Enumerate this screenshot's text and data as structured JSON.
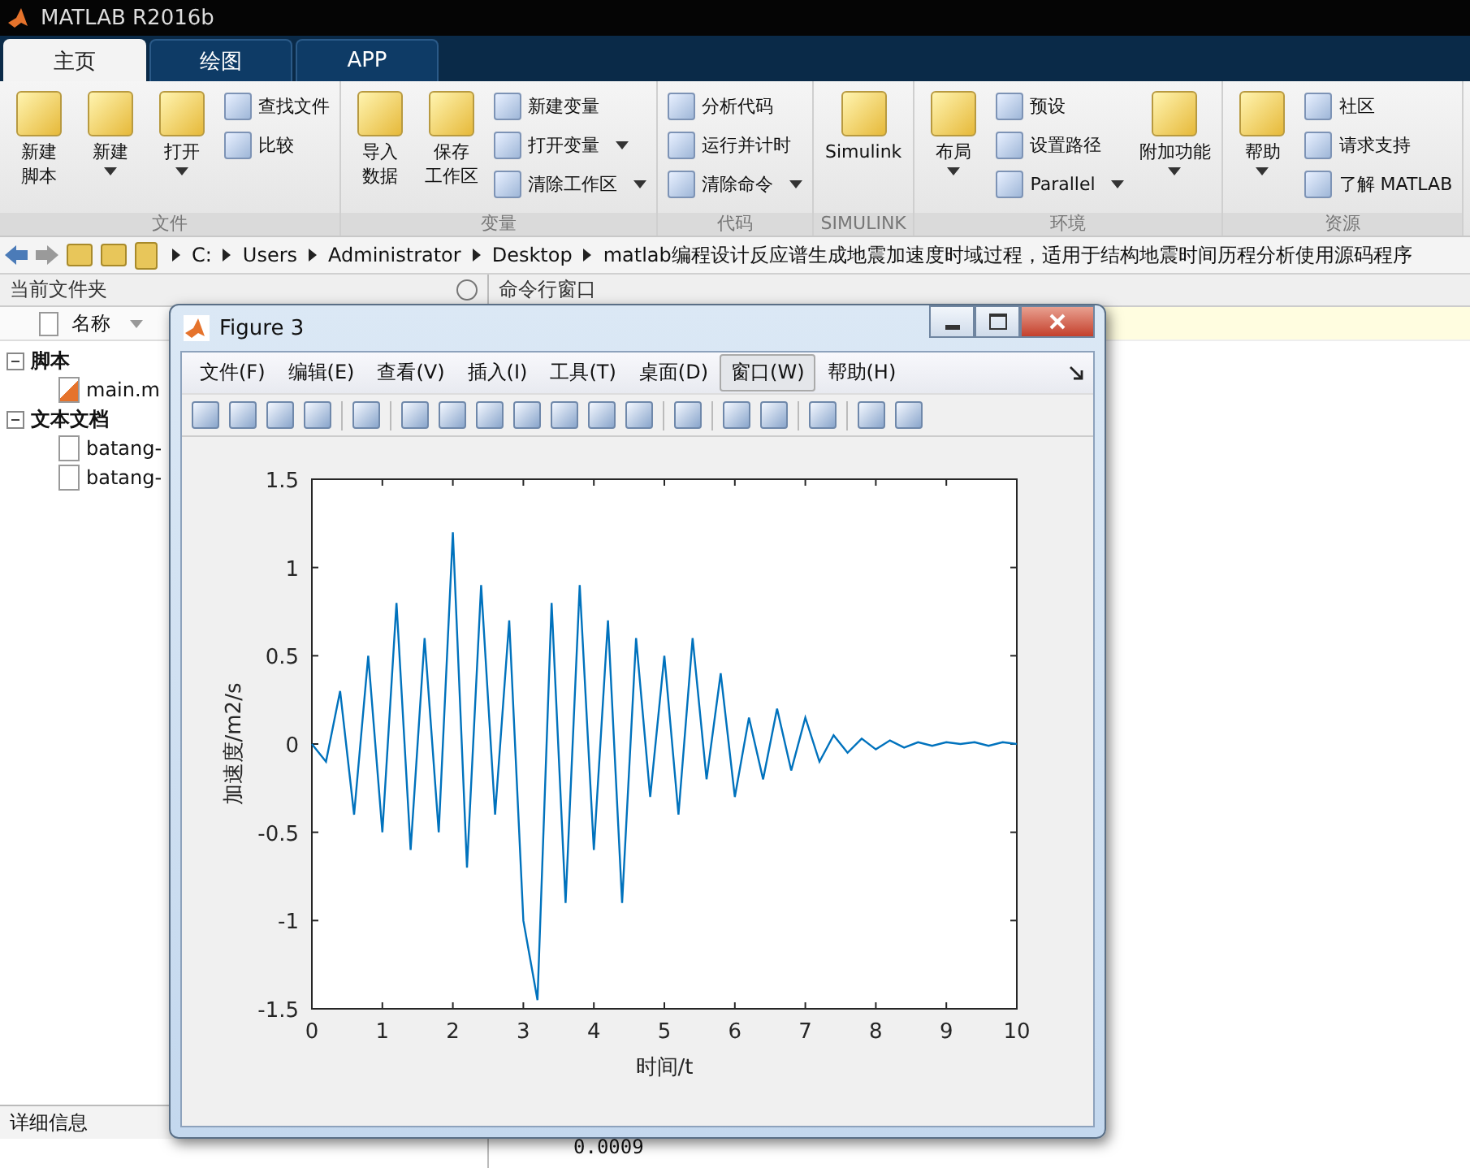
{
  "window": {
    "title": "MATLAB R2016b"
  },
  "tabs": [
    {
      "label": "主页",
      "selected": true
    },
    {
      "label": "绘图",
      "selected": false
    },
    {
      "label": "APP",
      "selected": false
    }
  ],
  "toolstrip": {
    "sections": [
      {
        "label": "文件",
        "items": [
          {
            "kind": "large",
            "lines": [
              "新建",
              "脚本"
            ],
            "dropdown": false
          },
          {
            "kind": "large",
            "lines": [
              "新建"
            ],
            "dropdown": true
          },
          {
            "kind": "large",
            "lines": [
              "打开"
            ],
            "dropdown": true
          },
          {
            "kind": "column",
            "rows": [
              {
                "label": "查找文件",
                "dropdown": false
              },
              {
                "label": "比较",
                "dropdown": false
              }
            ]
          }
        ]
      },
      {
        "label": "变量",
        "items": [
          {
            "kind": "large",
            "lines": [
              "导入",
              "数据"
            ],
            "dropdown": false
          },
          {
            "kind": "large",
            "lines": [
              "保存",
              "工作区"
            ],
            "dropdown": false
          },
          {
            "kind": "column",
            "rows": [
              {
                "label": "新建变量",
                "dropdown": false
              },
              {
                "label": "打开变量",
                "dropdown": true
              },
              {
                "label": "清除工作区",
                "dropdown": true
              }
            ]
          }
        ]
      },
      {
        "label": "代码",
        "items": [
          {
            "kind": "column",
            "rows": [
              {
                "label": "分析代码",
                "dropdown": false
              },
              {
                "label": "运行并计时",
                "dropdown": false
              },
              {
                "label": "清除命令",
                "dropdown": true
              }
            ]
          }
        ]
      },
      {
        "label": "SIMULINK",
        "items": [
          {
            "kind": "large",
            "lines": [
              "Simulink"
            ],
            "dropdown": false
          }
        ]
      },
      {
        "label": "环境",
        "items": [
          {
            "kind": "large",
            "lines": [
              "布局"
            ],
            "dropdown": true
          },
          {
            "kind": "column",
            "rows": [
              {
                "label": "预设",
                "dropdown": false
              },
              {
                "label": "设置路径",
                "dropdown": false
              },
              {
                "label": "Parallel",
                "dropdown": true
              }
            ]
          },
          {
            "kind": "large",
            "lines": [
              "附加功能"
            ],
            "dropdown": true
          }
        ]
      },
      {
        "label": "资源",
        "items": [
          {
            "kind": "large",
            "lines": [
              "帮助"
            ],
            "dropdown": true
          },
          {
            "kind": "column",
            "rows": [
              {
                "label": "社区",
                "dropdown": false
              },
              {
                "label": "请求支持",
                "dropdown": false
              },
              {
                "label": "了解 MATLAB",
                "dropdown": false
              }
            ]
          }
        ]
      }
    ]
  },
  "address_bar": {
    "path": [
      "C:",
      "Users",
      "Administrator",
      "Desktop",
      "matlab编程设计反应谱生成地震加速度时域过程，适用于结构地震时间历程分析使用源码程序"
    ]
  },
  "current_folder": {
    "title": "当前文件夹",
    "column": "名称",
    "tree": [
      {
        "label": "脚本",
        "expanded": true,
        "children": [
          {
            "label": "main.m",
            "kind": "script"
          }
        ]
      },
      {
        "label": "文本文档",
        "expanded": true,
        "children": [
          {
            "label": "batang-",
            "kind": "text"
          },
          {
            "label": "batang-",
            "kind": "text"
          }
        ]
      }
    ],
    "details": "详细信息"
  },
  "command_window": {
    "title": "命令行窗口",
    "output": [
      "0.0009"
    ]
  },
  "figure": {
    "title": "Figure 3",
    "menu": [
      {
        "label": "文件(F)",
        "selected": false
      },
      {
        "label": "编辑(E)",
        "selected": false
      },
      {
        "label": "查看(V)",
        "selected": false
      },
      {
        "label": "插入(I)",
        "selected": false
      },
      {
        "label": "工具(T)",
        "selected": false
      },
      {
        "label": "桌面(D)",
        "selected": false
      },
      {
        "label": "窗口(W)",
        "selected": true
      },
      {
        "label": "帮助(H)",
        "selected": false
      }
    ],
    "chart_data": {
      "type": "line",
      "xlabel": "时间/t",
      "ylabel": "加速度/m2/s",
      "xlim": [
        0,
        10
      ],
      "ylim": [
        -1.5,
        1.5
      ],
      "xticks": [
        0,
        1,
        2,
        3,
        4,
        5,
        6,
        7,
        8,
        9,
        10
      ],
      "yticks": [
        -1.5,
        -1,
        -0.5,
        0,
        0.5,
        1,
        1.5
      ],
      "x": [
        0,
        0.2,
        0.4,
        0.6,
        0.8,
        1,
        1.2,
        1.4,
        1.6,
        1.8,
        2,
        2.2,
        2.4,
        2.6,
        2.8,
        3,
        3.2,
        3.4,
        3.6,
        3.8,
        4,
        4.2,
        4.4,
        4.6,
        4.8,
        5,
        5.2,
        5.4,
        5.6,
        5.8,
        6,
        6.2,
        6.4,
        6.6,
        6.8,
        7,
        7.2,
        7.4,
        7.6,
        7.8,
        8,
        8.2,
        8.4,
        8.6,
        8.8,
        9,
        9.2,
        9.4,
        9.6,
        9.8,
        10
      ],
      "series": [
        {
          "color": "#0072bd",
          "values": [
            0,
            -0.1,
            0.3,
            -0.4,
            0.5,
            -0.5,
            0.8,
            -0.6,
            0.6,
            -0.5,
            1.2,
            -0.7,
            0.9,
            -0.4,
            0.7,
            -1.0,
            -1.45,
            0.8,
            -0.9,
            0.9,
            -0.6,
            0.7,
            -0.9,
            0.6,
            -0.3,
            0.5,
            -0.4,
            0.6,
            -0.2,
            0.4,
            -0.3,
            0.15,
            -0.2,
            0.2,
            -0.15,
            0.15,
            -0.1,
            0.05,
            -0.05,
            0.03,
            -0.03,
            0.02,
            -0.02,
            0.01,
            -0.01,
            0.01,
            0,
            0.01,
            -0.01,
            0.01,
            0
          ]
        }
      ]
    }
  }
}
